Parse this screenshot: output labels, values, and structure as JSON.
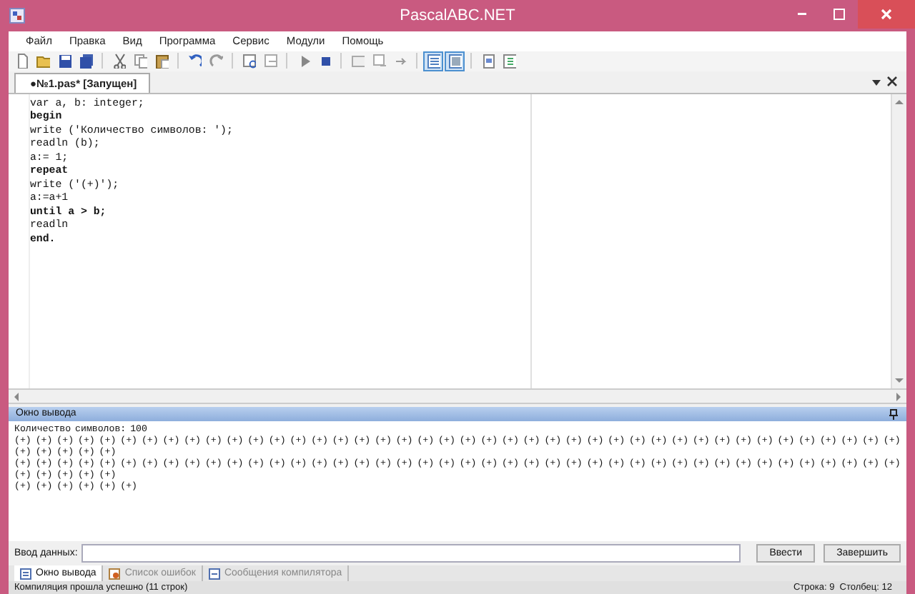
{
  "window": {
    "title": "PascalABC.NET"
  },
  "menu": [
    "Файл",
    "Правка",
    "Вид",
    "Программа",
    "Сервис",
    "Модули",
    "Помощь"
  ],
  "toolbar": {
    "buttons": [
      {
        "pressed": false
      },
      {
        "pressed": false
      },
      {
        "pressed": false
      },
      {
        "pressed": false
      },
      {
        "pressed": false
      },
      {
        "pressed": false
      },
      {
        "pressed": false
      },
      {
        "pressed": false
      },
      {
        "pressed": false
      },
      {
        "pressed": false
      },
      {
        "pressed": false
      },
      {
        "pressed": false
      },
      {
        "pressed": false
      },
      {
        "pressed": false
      },
      {
        "pressed": false
      },
      {
        "pressed": false
      },
      {
        "pressed": true
      },
      {
        "pressed": true
      },
      {
        "pressed": false
      },
      {
        "pressed": false
      }
    ]
  },
  "editor_tabs": [
    {
      "label": "●№1.pas* [Запущен]",
      "selected": true
    }
  ],
  "editor": {
    "lines": [
      {
        "text": "var a, b: integer;",
        "bold": false
      },
      {
        "text": "begin",
        "bold": true
      },
      {
        "text": "write ('Количество символов: ');",
        "bold": false
      },
      {
        "text": "readln (b);",
        "bold": false
      },
      {
        "text": "a:= 1;",
        "bold": false
      },
      {
        "text": "repeat",
        "bold": true
      },
      {
        "text": "write ('(+)');",
        "bold": false
      },
      {
        "text": "a:=a+1",
        "bold": false
      },
      {
        "text": "until a > b;",
        "bold": true
      },
      {
        "text": "readln",
        "bold": false
      },
      {
        "text": "end.",
        "bold": true
      }
    ]
  },
  "output_panel": {
    "title": "Окно вывода",
    "lines": [
      "Количество символов: 100",
      "(+) (+) (+) (+) (+) (+) (+) (+) (+) (+) (+) (+) (+) (+) (+) (+) (+) (+) (+) (+) (+) (+) (+) (+) (+) (+) (+) (+) (+) (+) (+) (+) (+) (+) (+) (+) (+) (+) (+) (+) (+) (+) (+) (+) (+) (+) (+)",
      "(+) (+) (+) (+) (+) (+) (+) (+) (+) (+) (+) (+) (+) (+) (+) (+) (+) (+) (+) (+) (+) (+) (+) (+) (+) (+) (+) (+) (+) (+) (+) (+) (+) (+) (+) (+) (+) (+) (+) (+) (+) (+) (+) (+) (+) (+) (+)",
      "(+) (+) (+) (+) (+) (+)"
    ]
  },
  "input_row": {
    "label": "Ввод данных:",
    "buttons": [
      "Ввести",
      "Завершить"
    ]
  },
  "bottom_tabs": [
    {
      "label": "Окно вывода",
      "selected": true
    },
    {
      "label": "Список ошибок",
      "selected": false
    },
    {
      "label": "Сообщения компилятора",
      "selected": false
    }
  ],
  "status_bar": {
    "message": "Компиляция прошла успешно (11 строк)",
    "position": "Строка: 9  Столбец: 12"
  }
}
